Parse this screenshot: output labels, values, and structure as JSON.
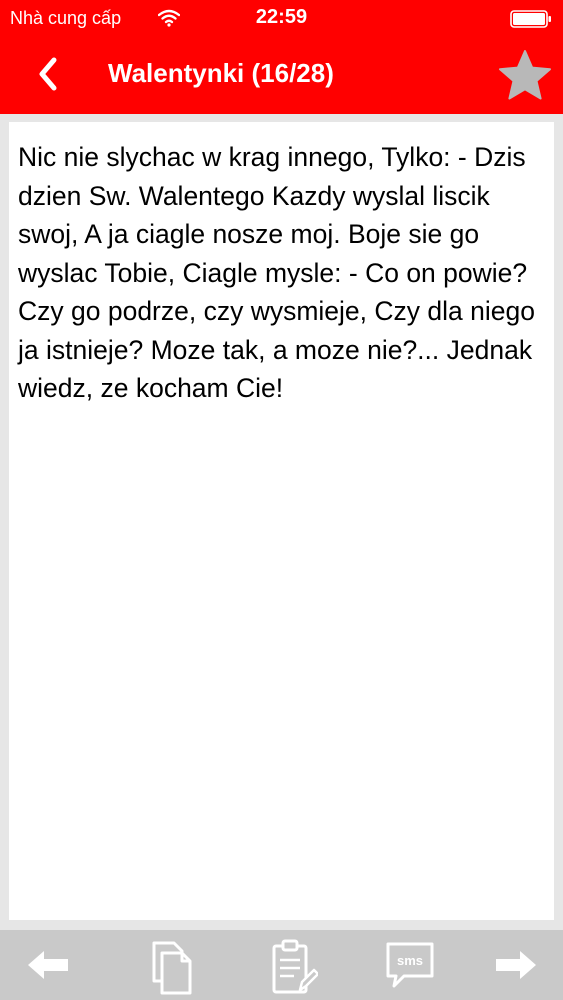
{
  "status_bar": {
    "carrier": "Nhà cung cấp",
    "time": "22:59"
  },
  "nav": {
    "title": "Walentynki (16/28)"
  },
  "message": {
    "text": "Nic nie slychac w krag innego, Tylko: - Dzis dzien Sw. Walentego Kazdy wyslal liscik swoj, A ja ciagle nosze moj. Boje sie go wyslac Tobie, Ciagle mysle: - Co on powie? Czy go podrze, czy wysmieje, Czy dla niego ja istnieje? Moze tak, a moze nie?... Jednak wiedz, ze kocham Cie!"
  },
  "toolbar": {
    "sms_label": "sms"
  },
  "colors": {
    "brand": "#ff0000",
    "toolbar_bg": "#c9c9c9",
    "page_bg": "#e6e6e6"
  },
  "icons": {
    "wifi": "wifi-icon",
    "battery": "battery-icon",
    "back": "chevron-left-icon",
    "favorite": "star-icon",
    "previous": "arrow-left-icon",
    "copy": "copy-icon",
    "clipboard": "clipboard-edit-icon",
    "sms": "sms-bubble-icon",
    "next": "arrow-right-icon"
  }
}
